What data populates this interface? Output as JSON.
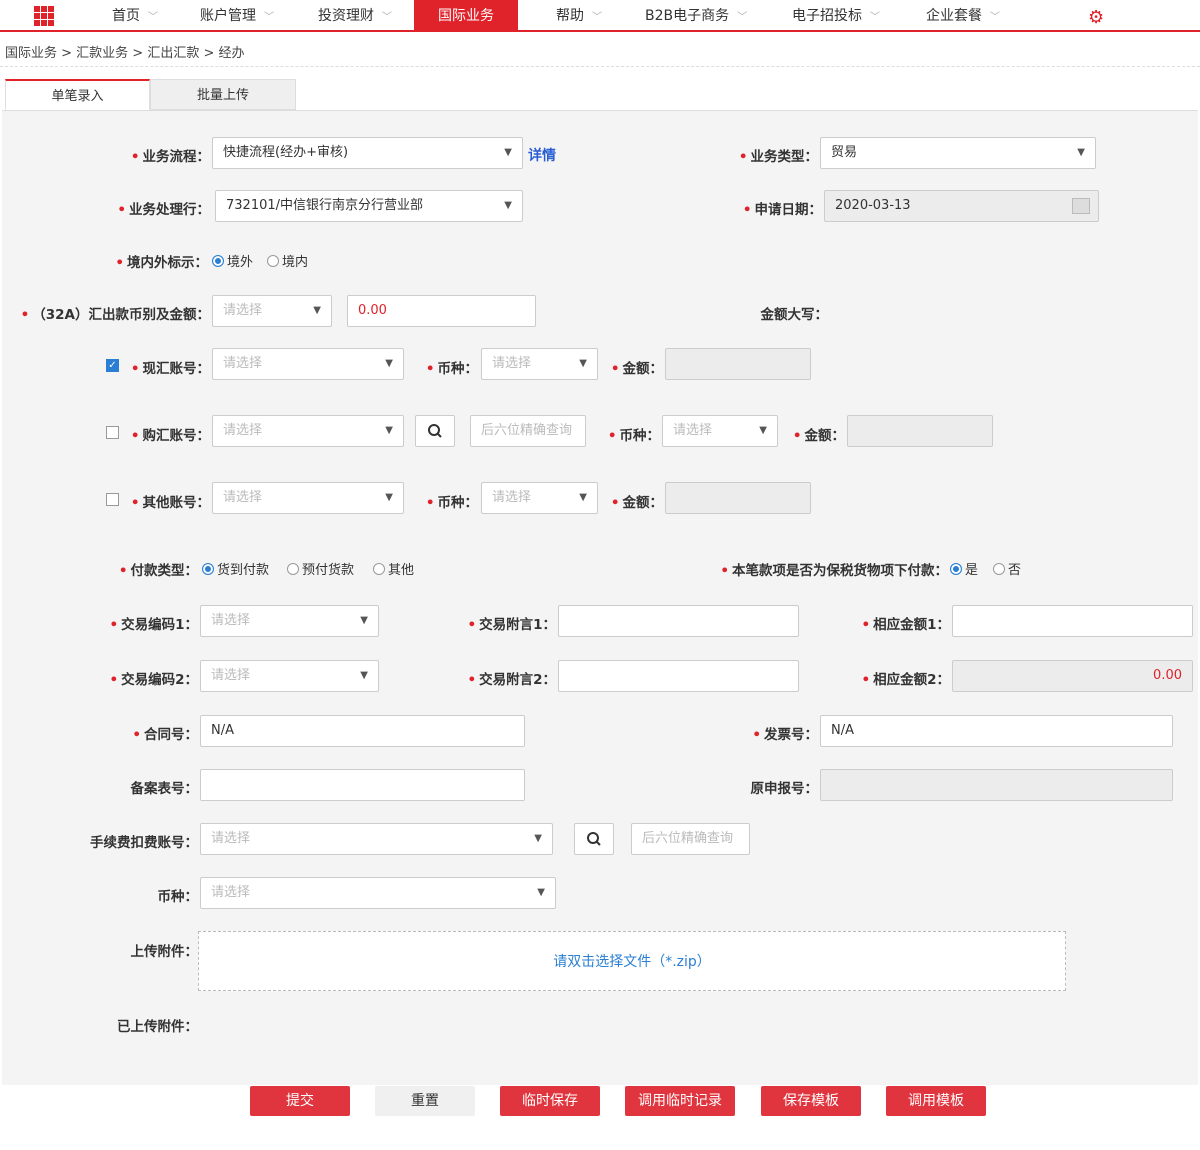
{
  "nav": {
    "items": [
      "首页",
      "账户管理",
      "投资理财",
      "国际业务",
      "帮助",
      "B2B电子商务",
      "电子招投标",
      "企业套餐"
    ]
  },
  "breadcrumb": "国际业务 > 汇款业务 > 汇出汇款 > 经办",
  "tabs": [
    "单笔录入",
    "批量上传"
  ],
  "form": {
    "flow_label": "业务流程：",
    "flow_value": "快捷流程(经办+审核)",
    "detail_link": "详情",
    "type_label": "业务类型：",
    "type_value": "贸易",
    "bank_label": "业务处理行：",
    "bank_value": "732101/中信银行南京分行营业部",
    "date_label": "申请日期：",
    "date_value": "2020-03-13",
    "domestic_label": "境内外标示：",
    "domestic_opt1": "境外",
    "domestic_opt2": "境内",
    "amount_label": "（32A）汇出款币别及金额：",
    "amount_currency": "请选择",
    "amount_value": "0.00",
    "amount_caps_label": "金额大写：",
    "spot_label": "现汇账号：",
    "buy_label": "购汇账号：",
    "other_label": "其他账号：",
    "currency_label": "币种：",
    "money_label": "金额：",
    "placeholder": "请选择",
    "search_placeholder": "后六位精确查询",
    "paytype_label": "付款类型：",
    "paytype_opts": [
      "货到付款",
      "预付货款",
      "其他"
    ],
    "bonded_label": "本笔款项是否为保税货物项下付款：",
    "bonded_yes": "是",
    "bonded_no": "否",
    "code1_label": "交易编码1：",
    "note1_label": "交易附言1：",
    "amt1_label": "相应金额1：",
    "code2_label": "交易编码2：",
    "note2_label": "交易附言2：",
    "amt2_label": "相应金额2：",
    "amt2_value": "0.00",
    "contract_label": "合同号：",
    "contract_value": "N/A",
    "invoice_label": "发票号：",
    "invoice_value": "N/A",
    "record_label": "备案表号：",
    "orig_label": "原申报号：",
    "fee_label": "手续费扣费账号：",
    "fee_currency_label": "币种：",
    "upload_label": "上传附件：",
    "upload_hint": "请双击选择文件（*.zip）",
    "uploaded_label": "已上传附件："
  },
  "buttons": [
    "提交",
    "重置",
    "临时保存",
    "调用临时记录",
    "保存模板",
    "调用模板"
  ]
}
